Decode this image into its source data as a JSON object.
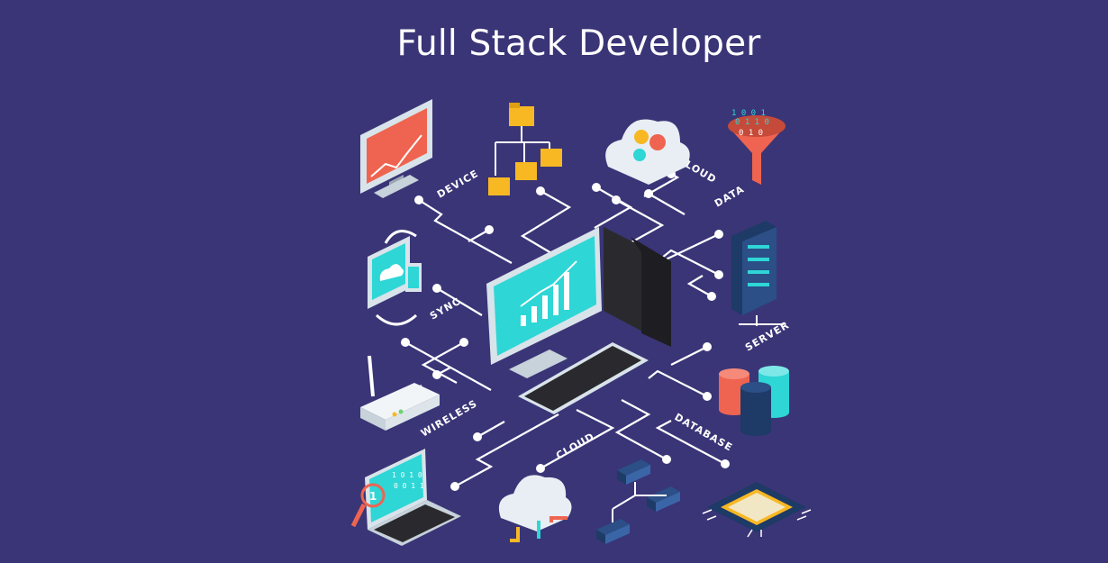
{
  "title": "Full Stack Developer",
  "labels": {
    "device": "DEVICE",
    "cloud_top": "CLOUD",
    "data": "DATA",
    "sync": "SYNC",
    "server": "SERVER",
    "wireless": "WIRELESS",
    "cloud_bottom": "CLOUD",
    "database": "DATABASE"
  },
  "laptop_badge": "1",
  "colors": {
    "background": "#3a3577",
    "screen_cyan": "#2ed6d6",
    "chart_red": "#ef6450",
    "folder_yellow": "#f7b823",
    "line": "#ffffff"
  },
  "icons": [
    "monitor-chart-icon",
    "folder-tree-icon",
    "cloud-gears-icon",
    "data-funnel-icon",
    "server-rack-icon",
    "sync-devices-icon",
    "desktop-computer-icon",
    "router-icon",
    "database-stack-icon",
    "laptop-search-icon",
    "cloud-transfer-icon",
    "network-switch-icon",
    "cpu-chip-icon"
  ]
}
